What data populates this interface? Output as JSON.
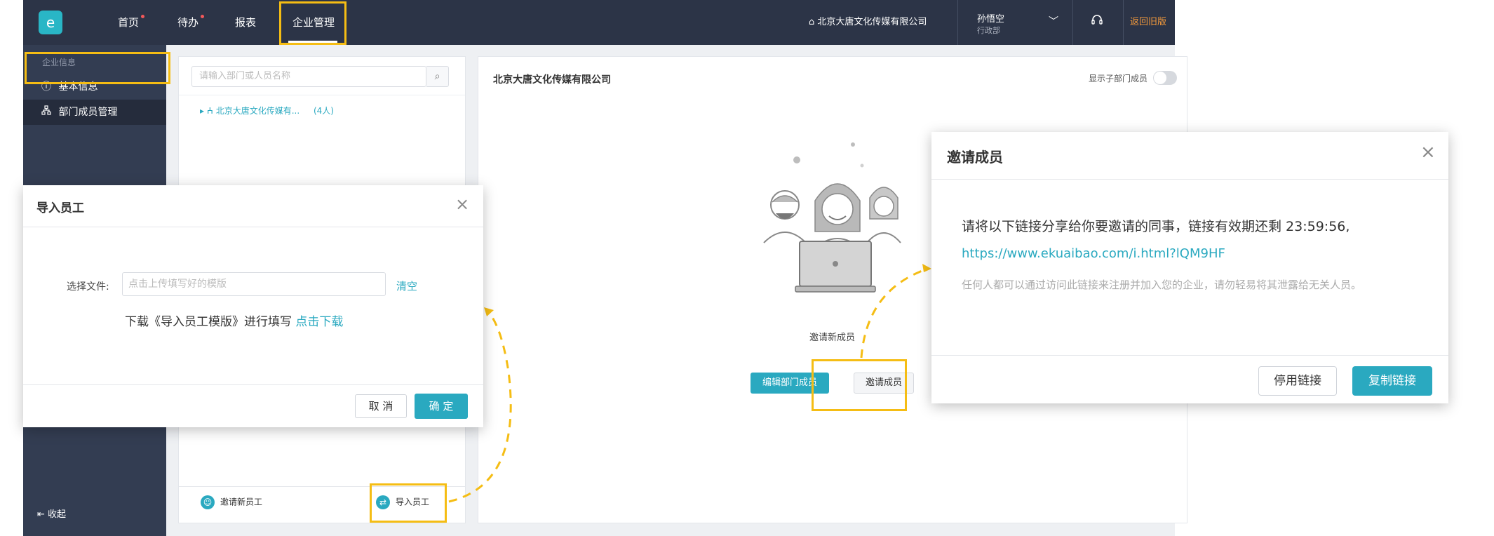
{
  "topbar": {
    "logo": "e",
    "nav": [
      {
        "label": "首页",
        "dot": true
      },
      {
        "label": "待办",
        "dot": true
      },
      {
        "label": "报表",
        "dot": false
      },
      {
        "label": "企业管理",
        "dot": false
      }
    ],
    "company": "北京大唐文化传媒有限公司",
    "user_name": "孙悟空",
    "user_dept": "行政部",
    "back_old": "返回旧版"
  },
  "sidebar": {
    "section": "企业信息",
    "items": [
      {
        "label": "基本信息",
        "icon": "info-icon"
      },
      {
        "label": "部门成员管理",
        "icon": "org-icon"
      }
    ],
    "collapse": "收起"
  },
  "tree": {
    "search_placeholder": "请输入部门或人员名称",
    "root_label": "北京大唐文化传媒有...",
    "root_count": "(4人)",
    "invite_new_staff": "邀请新员工",
    "import_staff": "导入员工"
  },
  "main": {
    "title": "北京大唐文化传媒有限公司",
    "show_sub_members": "显示子部门成员",
    "invite_new_member": "邀请新成员",
    "edit_dept_members": "编辑部门成员",
    "invite_members": "邀请成员"
  },
  "modal_import": {
    "title": "导入员工",
    "file_label": "选择文件:",
    "file_placeholder": "点击上传填写好的模版",
    "clear": "清空",
    "download_text": "下载《导入员工模版》进行填写",
    "download_link": "点击下载",
    "cancel": "取 消",
    "ok": "确 定"
  },
  "modal_invite": {
    "title": "邀请成员",
    "message": "请将以下链接分享给你要邀请的同事，链接有效期还剩 23:59:56,",
    "link": "https://www.ekuaibao.com/i.html?lQM9HF",
    "note": "任何人都可以通过访问此链接来注册并加入您的企业，请勿轻易将其泄露给无关人员。",
    "disable_link": "停用链接",
    "copy_link": "复制链接"
  },
  "colors": {
    "accent": "#2aa9c0",
    "highlight": "#f5bd14",
    "topbar": "#2c3447",
    "sidebar": "#333d52"
  }
}
